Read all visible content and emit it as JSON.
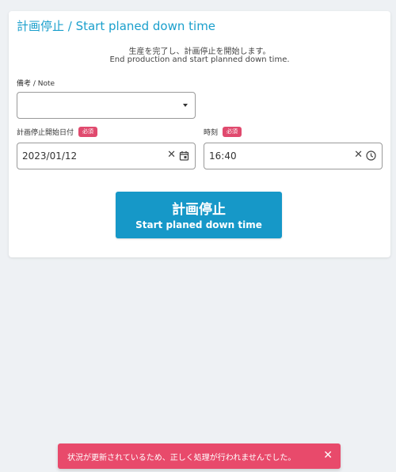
{
  "dialog": {
    "title": "計画停止 / Start planed down time",
    "description_jp": "生産を完了し、計画停止を開始します。",
    "description_en": "End production and start planned down time."
  },
  "note_field": {
    "label": "備考 / Note",
    "value": ""
  },
  "date_field": {
    "label": "計画停止開始日付",
    "required_badge": "必須",
    "value": "2023/01/12"
  },
  "time_field": {
    "label": "時刻",
    "required_badge": "必須",
    "value": "16:40"
  },
  "primary_button": {
    "label_jp": "計画停止",
    "label_en": "Start planed down time"
  },
  "toast": {
    "message": "状況が更新されているため、正しく処理が行われませんでした。",
    "close_glyph": "✕"
  },
  "icons": {
    "clear_glyph": "✕",
    "date_icon": "calendar-icon",
    "time_icon": "clock-icon",
    "select_icon": "dropdown-arrow-icon"
  },
  "colors": {
    "accent": "#1a9fcc",
    "button": "#1698c8",
    "required_badge": "#e04a6e",
    "toast": "#e84a6b",
    "background": "#eef1f4"
  }
}
